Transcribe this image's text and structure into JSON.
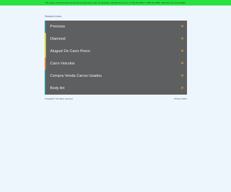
{
  "banner": {
    "text": "The owner of this domain has put this domain up for sale. To purchase, call Afternic.com at +1 781-373-6847 or 855-201-0995. Click here for more details."
  },
  "related_links": {
    "label": "Related Links",
    "items": [
      {
        "label": "Preciosa",
        "accent": "#2e8fa8"
      },
      {
        "label": "Diamond",
        "accent": "#d7cf3a"
      },
      {
        "label": "Aluguel De Carro Preco",
        "accent": "#d7cf3a"
      },
      {
        "label": "Carro Veiculos",
        "accent": "#d6803b"
      },
      {
        "label": "Compra Venda Carros Usados",
        "accent": "#2f8c92"
      },
      {
        "label": "Body Art",
        "accent": "#2f8c92"
      }
    ],
    "chevron": "»"
  },
  "footer": {
    "copyright": "Copyright © All rights reserved",
    "privacy": "Privacy Policy"
  },
  "colors": {
    "page_bg": "#eef6fd",
    "banner_bg": "#27e23f",
    "item_bg": "#5e5f60",
    "chevron": "#f0a020"
  }
}
